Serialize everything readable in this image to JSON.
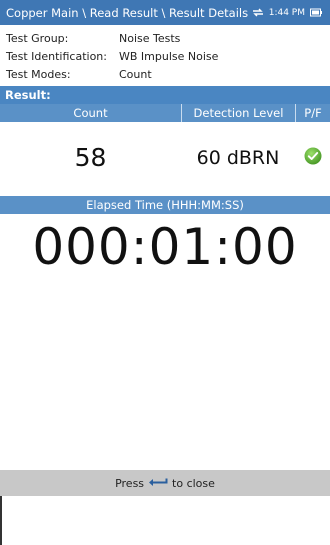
{
  "titlebar": {
    "breadcrumb": "Copper Main \\ Read Result \\ Result Details",
    "time": "1:44 PM"
  },
  "info": {
    "rows": [
      {
        "label": "Test Group:",
        "value": "Noise Tests"
      },
      {
        "label": "Test Identification:",
        "value": "WB Impulse Noise"
      },
      {
        "label": "Test Modes:",
        "value": "Count"
      }
    ]
  },
  "result": {
    "label": "Result:",
    "headers": {
      "count": "Count",
      "detection": "Detection Level",
      "pf": "P/F"
    },
    "count_value": "58",
    "detection_value": "60 dBRN",
    "pf_status": "pass",
    "pass_color": "#5aa832"
  },
  "elapsed": {
    "header": "Elapsed Time (HHH:MM:SS)",
    "value": "000:01:00"
  },
  "footer": {
    "press": "Press",
    "to_close": "to close",
    "icon": "enter-arrow-icon"
  },
  "colors": {
    "titlebar": "#3f77b4",
    "result_bar": "#4a86c2",
    "header": "#5a91c7",
    "footer": "#c8c8c8"
  }
}
